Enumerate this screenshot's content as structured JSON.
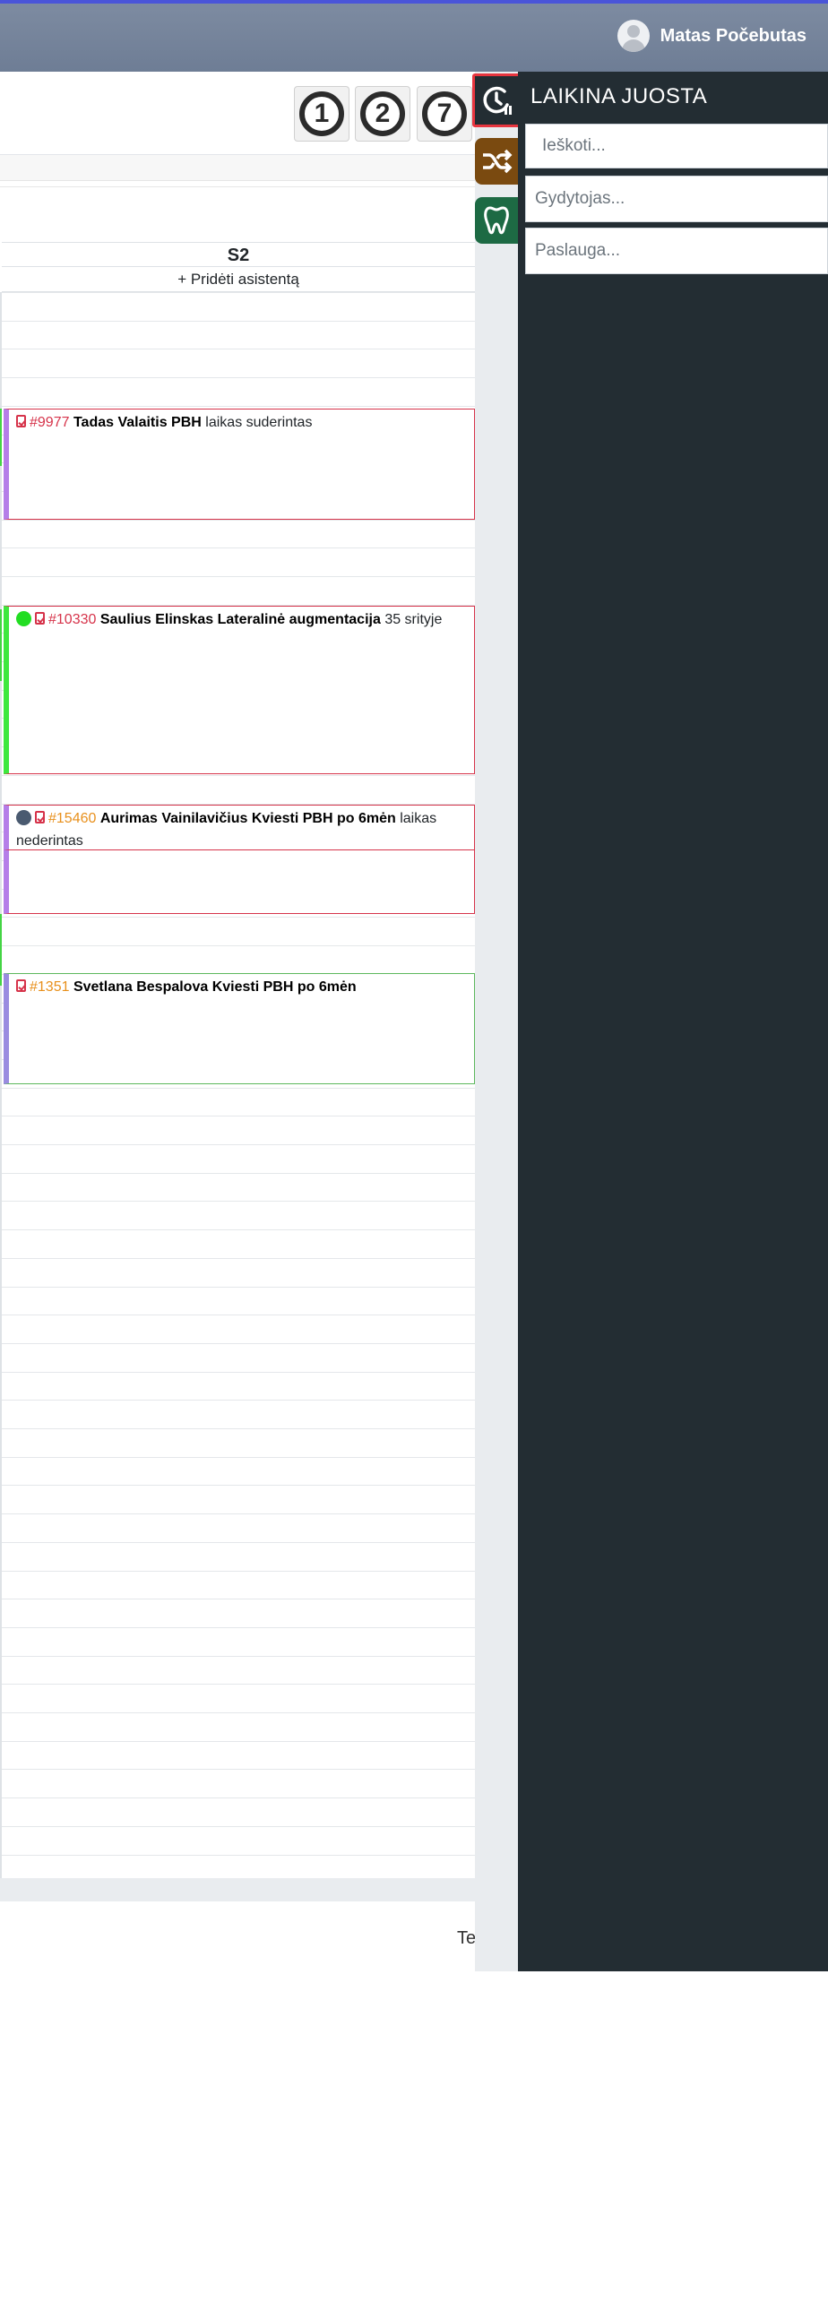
{
  "header": {
    "user_name": "Matas Počebutas"
  },
  "toolbar": {
    "buttons": [
      "1",
      "2",
      "7"
    ]
  },
  "column": {
    "title": "S2",
    "add_assistant": "+ Pridėti asistentą"
  },
  "appointments": [
    {
      "number": "#9977",
      "name": "Tadas Valaitis PBH",
      "note": "laikas suderintas",
      "number_color": "#d6334a",
      "border_color": "#d6334a",
      "bar_color": "#b57ee8",
      "status_dot": null
    },
    {
      "number": "#10330",
      "name": "Saulius Elinskas Lateralinė augmentacija",
      "note": "35 srityje",
      "number_color": "#d6334a",
      "border_color": "#d6334a",
      "bar_color": "#3ee83e",
      "status_dot": "#22dd22"
    },
    {
      "number": "#15460",
      "name": "Aurimas Vainilavičius Kviesti PBH po 6mėn",
      "note": "laikas nederintas",
      "number_color": "#e8901c",
      "border_color": "#d6334a",
      "bar_color": "#b57ee8",
      "status_dot": "#4a5a70"
    },
    {
      "number": "#1351",
      "name": "Svetlana Bespalova Kviesti PBH po 6mėn",
      "note": "",
      "number_color": "#e8901c",
      "border_color": "#5cb85c",
      "bar_color": "#9a8ce0",
      "status_dot": null
    }
  ],
  "footer": {
    "text": "Te"
  },
  "side_tabs": [
    {
      "icon": "clock-pause-icon",
      "color": "#232d33"
    },
    {
      "icon": "shuffle-icon",
      "color": "#7a4a10"
    },
    {
      "icon": "tooth-icon",
      "color": "#1d6a44"
    }
  ],
  "panel": {
    "title": "LAIKINA JUOSTA",
    "search_placeholder": "Ieškoti...",
    "doctor_placeholder": "Gydytojas...",
    "service_placeholder": "Paslauga..."
  }
}
